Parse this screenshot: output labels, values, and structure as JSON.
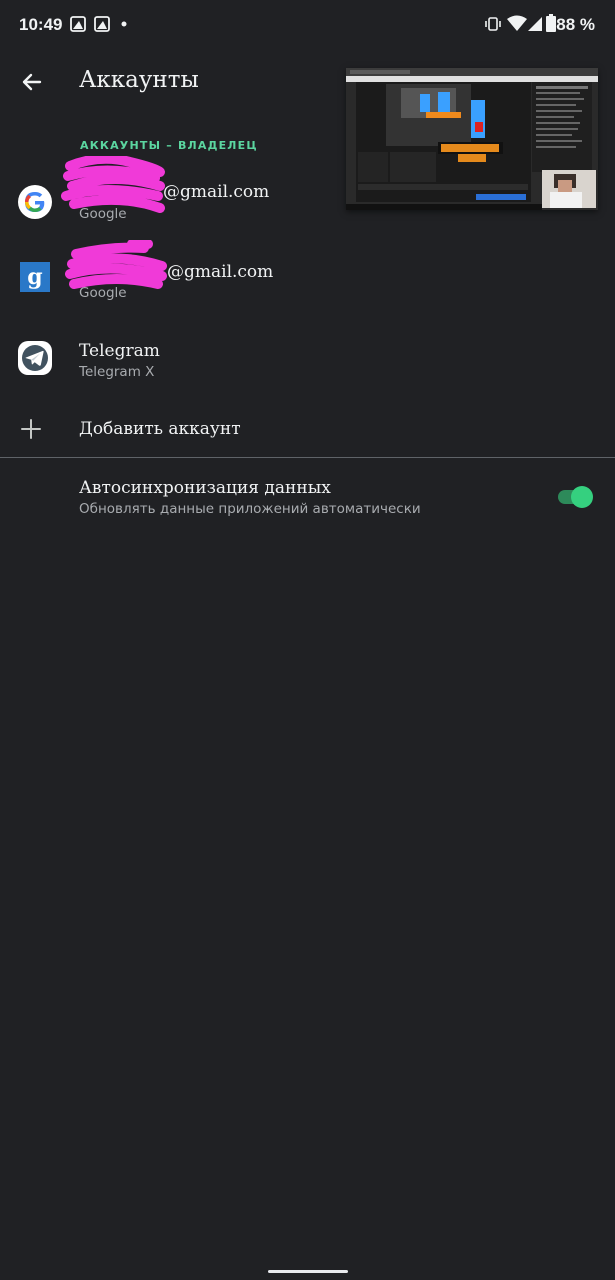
{
  "status_bar": {
    "time": "10:49",
    "battery": "88 %",
    "icons": [
      "photo-notification-icon",
      "photo-notification-icon",
      "notification-dot-icon",
      "vibrate-icon",
      "wifi-icon",
      "signal-icon",
      "battery-icon"
    ]
  },
  "app_bar": {
    "title": "Аккаунты",
    "back_icon": "arrow-back-icon"
  },
  "section": {
    "header": "АККАУНТЫ – ВЛАДЕЛЕЦ"
  },
  "accounts": [
    {
      "title": "@gmail.com",
      "subtitle": "Google",
      "icon": "google-g-icon"
    },
    {
      "title": "@gmail.com",
      "subtitle": "Google",
      "icon": "google-blue-g-icon"
    },
    {
      "title": "Telegram",
      "subtitle": "Telegram X",
      "icon": "telegram-icon"
    }
  ],
  "add_account": {
    "label": "Добавить аккаунт",
    "icon": "plus-icon"
  },
  "autosync": {
    "title": "Автосинхронизация данных",
    "subtitle": "Обновлять данные приложений автоматически",
    "enabled": true
  },
  "colors": {
    "background": "#202124",
    "accent": "#35d07f",
    "section_header": "#5bd6a0",
    "redaction": "#f03ad8"
  }
}
